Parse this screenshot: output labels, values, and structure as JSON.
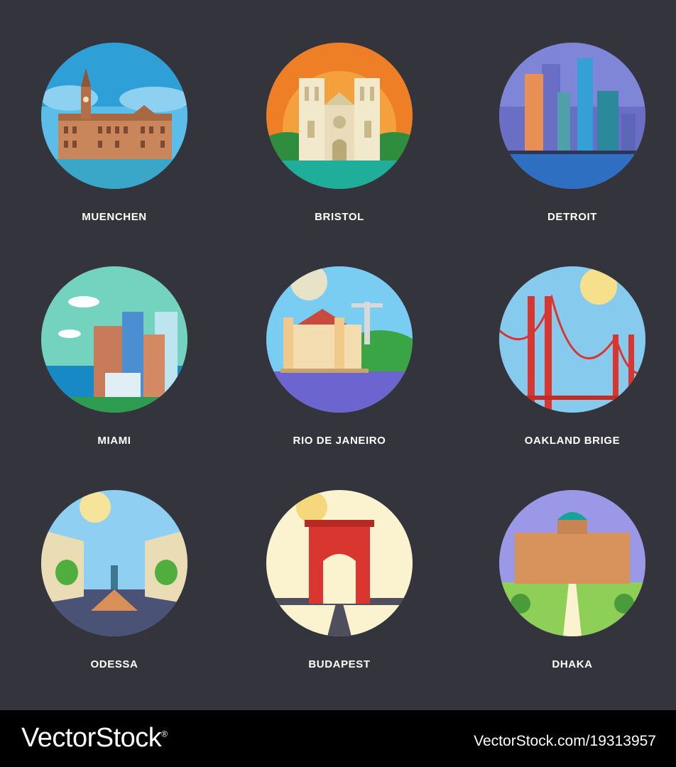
{
  "background": "#34353c",
  "cities": [
    {
      "label": "MUENCHEN",
      "icon": "muenchen-city-hall-icon"
    },
    {
      "label": "BRISTOL",
      "icon": "bristol-cathedral-icon"
    },
    {
      "label": "DETROIT",
      "icon": "detroit-skyline-icon"
    },
    {
      "label": "MIAMI",
      "icon": "miami-skyline-icon"
    },
    {
      "label": "RIO DE JANEIRO",
      "icon": "rio-de-janeiro-icon"
    },
    {
      "label": "OAKLAND BRIGE",
      "icon": "oakland-bridge-icon"
    },
    {
      "label": "ODESSA",
      "icon": "odessa-square-icon"
    },
    {
      "label": "BUDAPEST",
      "icon": "budapest-bridge-icon"
    },
    {
      "label": "DHAKA",
      "icon": "dhaka-palace-icon"
    }
  ],
  "footer": {
    "logo": "VectorStock",
    "logo_mark": "®",
    "reference": "VectorStock.com/19313957"
  }
}
